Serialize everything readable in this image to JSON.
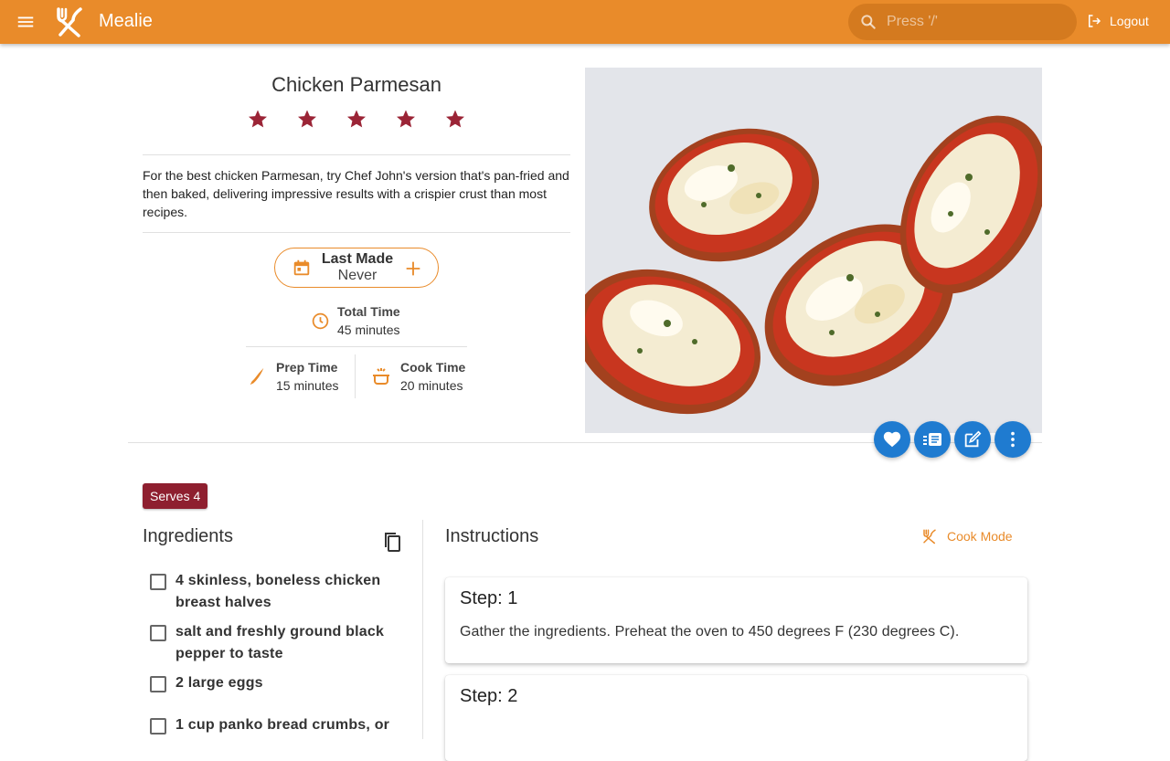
{
  "app": {
    "title": "Mealie",
    "search_placeholder": "Press '/'",
    "logout_label": "Logout",
    "accent_color": "#e98b2a"
  },
  "recipe": {
    "title": "Chicken Parmesan",
    "rating": 5,
    "rating_max": 5,
    "description": "For the best chicken Parmesan, try Chef John's version that's pan-fried and then baked, delivering impressive results with a crispier crust than most recipes.",
    "last_made_label": "Last Made",
    "last_made_value": "Never",
    "total_time_label": "Total Time",
    "total_time_value": "45 minutes",
    "prep_time_label": "Prep Time",
    "prep_time_value": "15 minutes",
    "cook_time_label": "Cook Time",
    "cook_time_value": "20 minutes",
    "serves_label": "Serves 4"
  },
  "ingredients": {
    "heading": "Ingredients",
    "items": [
      "4 skinless, boneless chicken breast halves",
      "salt and freshly ground black pepper to taste",
      "2 large eggs",
      "1 cup panko bread crumbs, or"
    ]
  },
  "instructions": {
    "heading": "Instructions",
    "cook_mode_label": "Cook Mode",
    "steps": [
      {
        "title": "Step: 1",
        "body": "Gather the ingredients. Preheat the oven to 450 degrees F (230 degrees C)."
      },
      {
        "title": "Step: 2",
        "body": ""
      }
    ]
  },
  "actions": {
    "favorite_icon": "heart-icon",
    "mealplan_icon": "list-add-icon",
    "edit_icon": "edit-icon",
    "more_icon": "dots-vertical-icon",
    "fab_color": "#1f7bd0",
    "star_color": "#9b2436",
    "serves_color": "#8e1f2f"
  }
}
